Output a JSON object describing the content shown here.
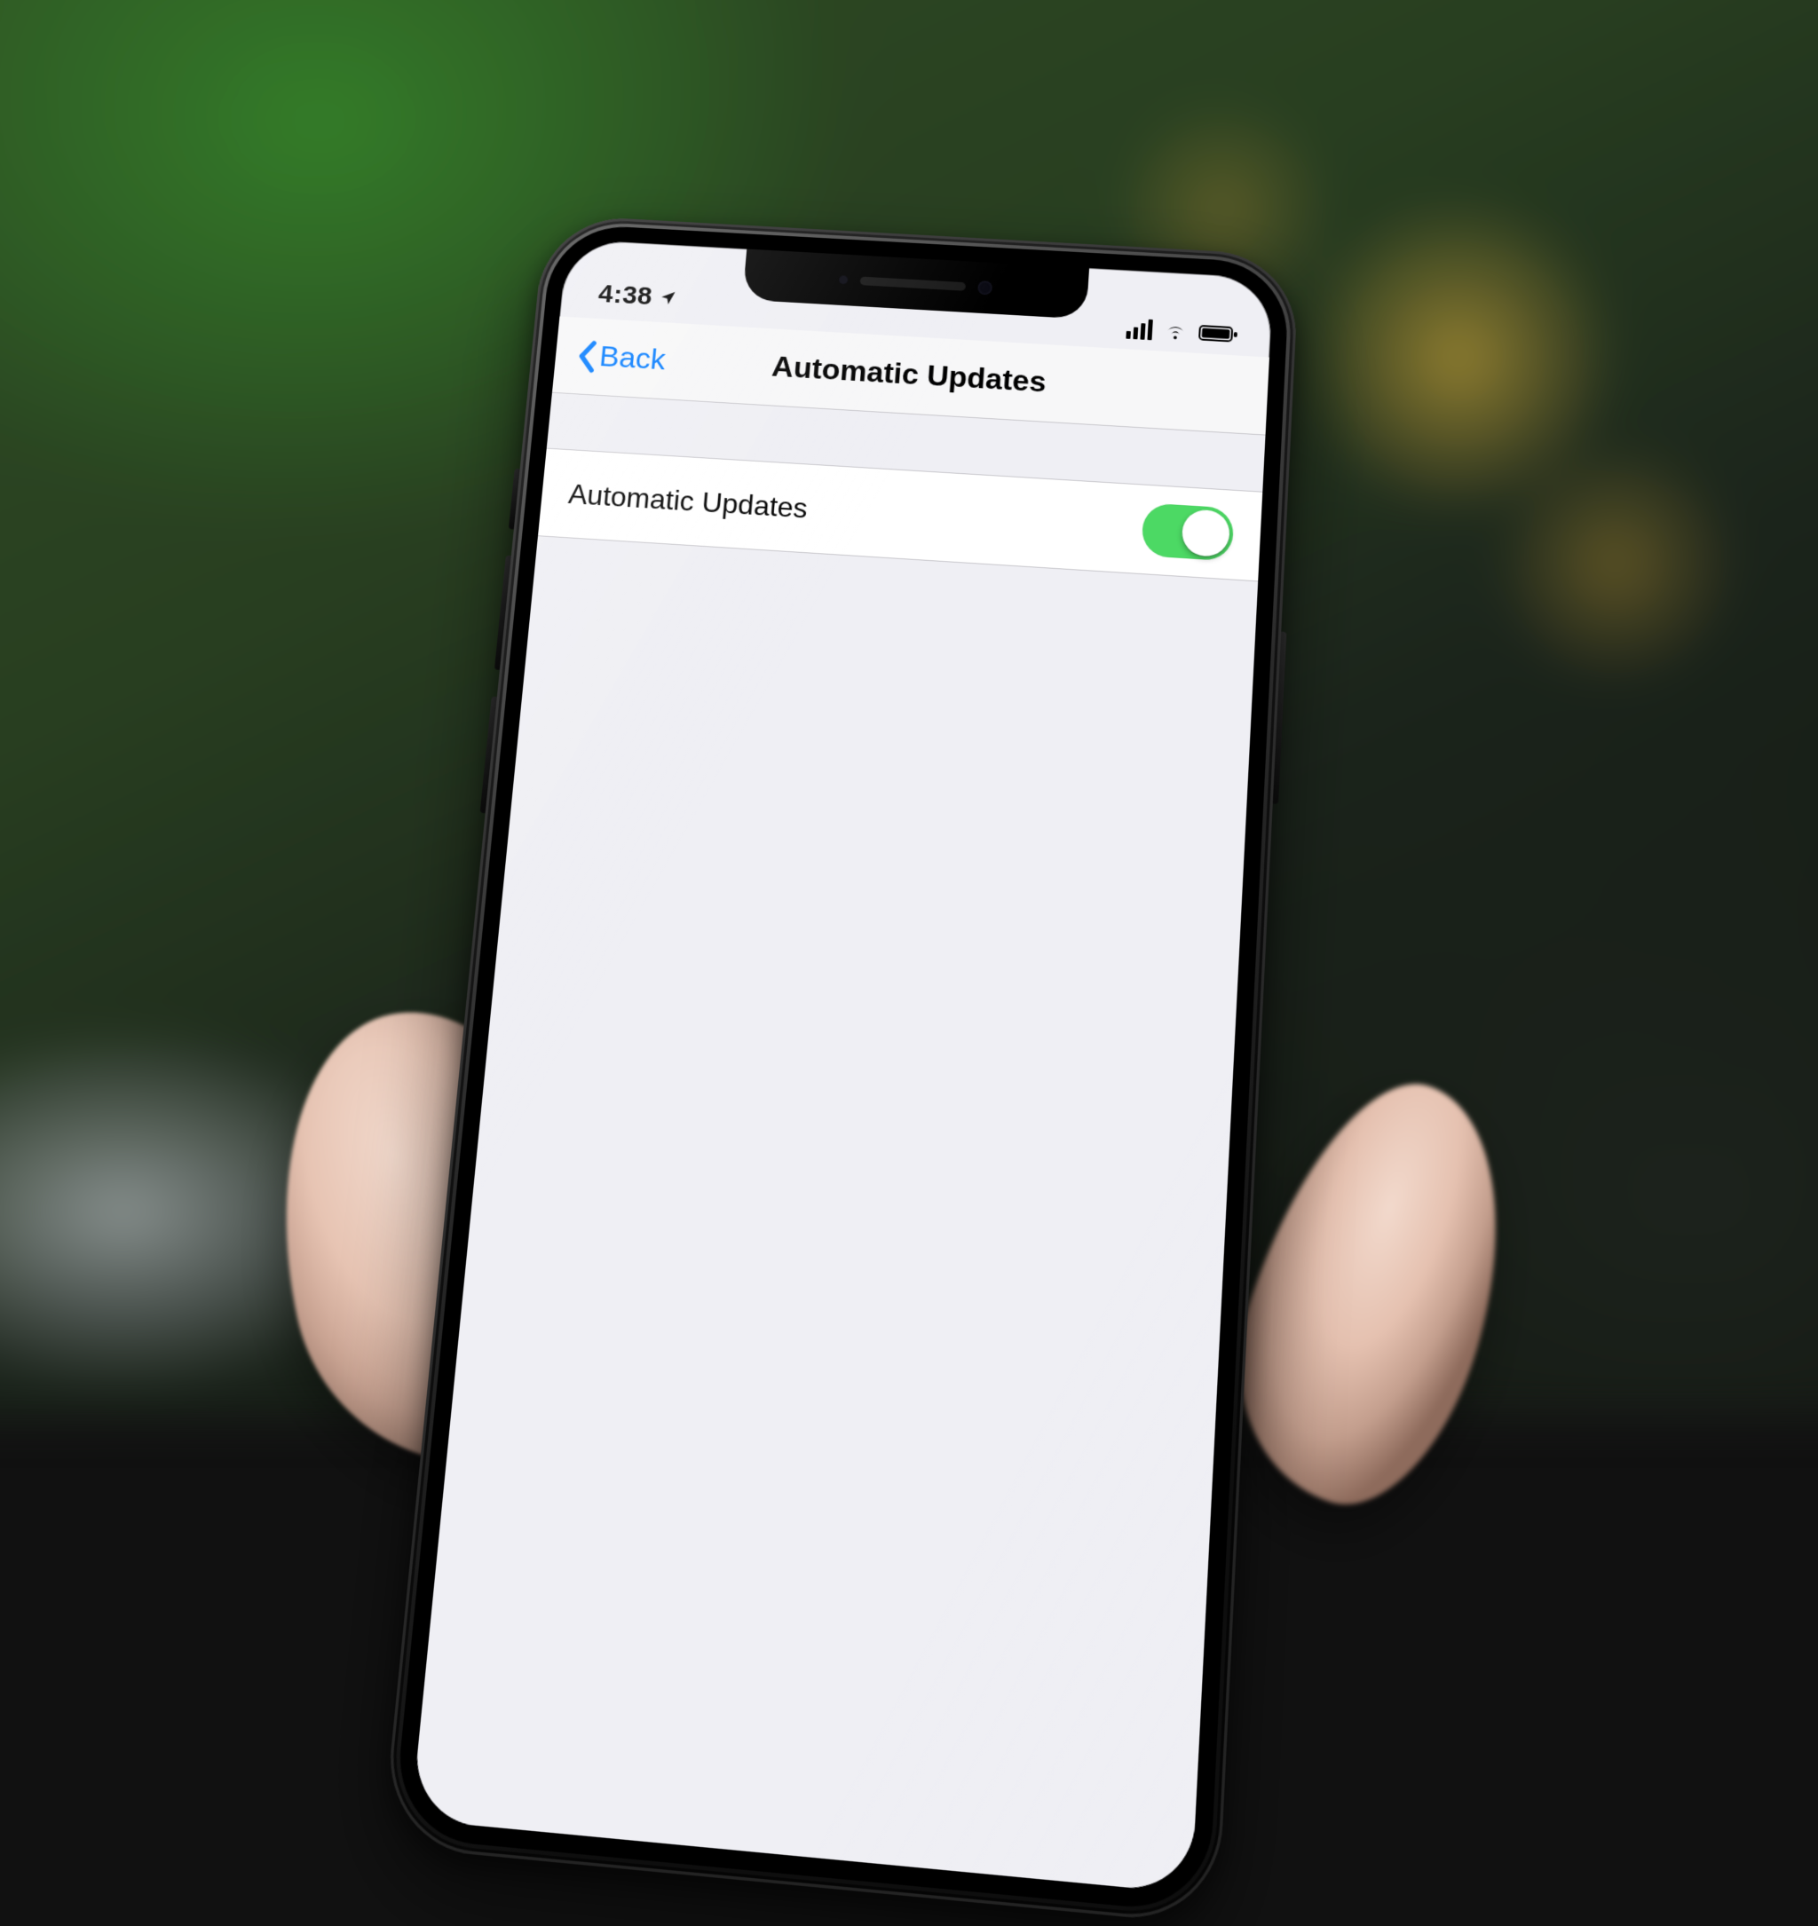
{
  "statusbar": {
    "time": "4:38"
  },
  "navbar": {
    "back_label": "Back",
    "title": "Automatic Updates"
  },
  "settings": {
    "automatic_updates": {
      "label": "Automatic Updates",
      "enabled": true
    }
  },
  "colors": {
    "ios_blue": "#007aff",
    "ios_green": "#4cd964",
    "group_bg": "#efeff4",
    "separator": "#c8c7cc"
  }
}
